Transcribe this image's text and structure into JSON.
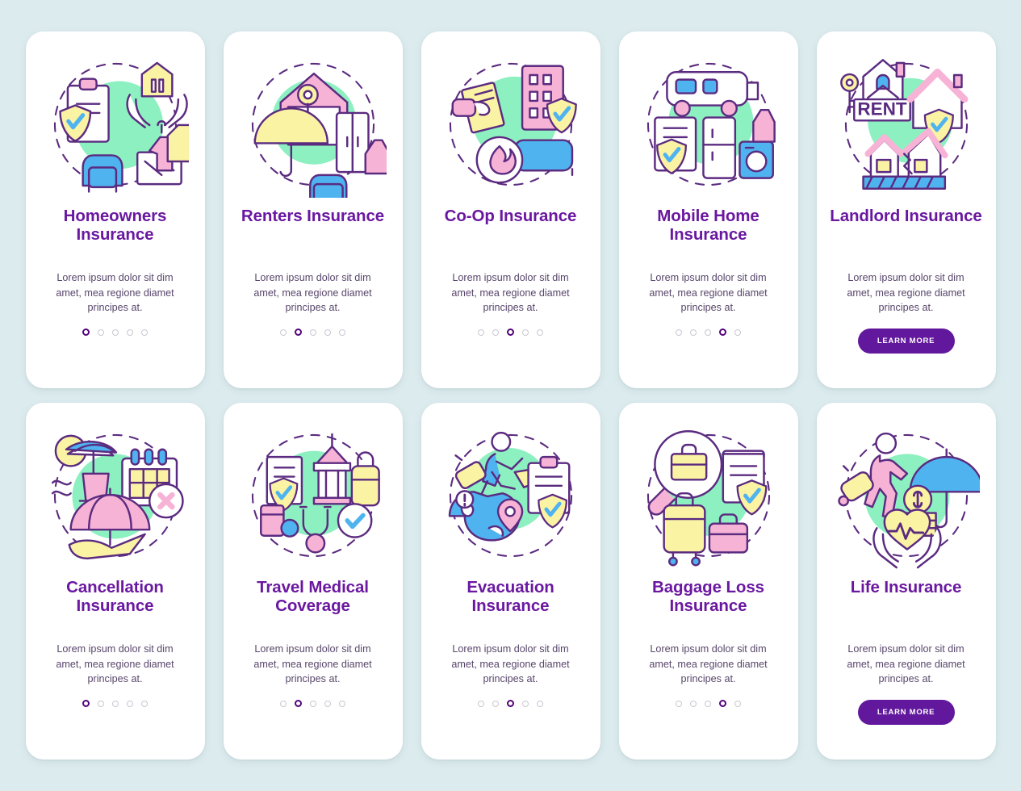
{
  "palette": {
    "page_background": "#dcebee",
    "card_background": "#ffffff",
    "title_purple": "#6a18a0",
    "body_text": "#58466b",
    "button_purple": "#62189c",
    "dot_active": "#53037a",
    "dot_inactive": "#c9c7d2",
    "illus_stroke": "#5b2b80",
    "illus_mint": "#8df0c0",
    "illus_yellow": "#fbf3a4",
    "illus_pink": "#f7b3d6",
    "illus_blue": "#4fb3f0",
    "illus_white": "#ffffff"
  },
  "shared": {
    "body_text": "Lorem ipsum dolor sit dim amet, mea regione diamet principes at.",
    "learn_more_label": "LEARN MORE",
    "dots_total": 5
  },
  "cards": [
    {
      "id": "homeowners-insurance",
      "title": "Homeowners Insurance",
      "body": "Lorem ipsum dolor sit dim amet, mea regione diamet principes at.",
      "footer": "dots",
      "dots_total": 5,
      "dots_active_index": 0,
      "illustration": "homeowners-illustration",
      "icon_elements": [
        "clipboard",
        "shield-check",
        "hands-holding-house",
        "armchair",
        "lamp",
        "table",
        "hanger-shirt"
      ]
    },
    {
      "id": "renters-insurance",
      "title": "Renters Insurance",
      "body": "Lorem ipsum dolor sit dim amet, mea regione diamet principes at.",
      "footer": "dots",
      "dots_total": 5,
      "dots_active_index": 1,
      "illustration": "renters-illustration",
      "icon_elements": [
        "house",
        "key",
        "umbrella",
        "sofa",
        "lamp",
        "wardrobe"
      ]
    },
    {
      "id": "co-op-insurance",
      "title": "Co-Op Insurance",
      "body": "Lorem ipsum dolor sit dim amet, mea regione diamet principes at.",
      "footer": "dots",
      "dots_total": 5,
      "dots_active_index": 2,
      "illustration": "coop-illustration",
      "icon_elements": [
        "hand-signing-contract",
        "apartment-building",
        "shield-check",
        "fire-circle",
        "sofa"
      ]
    },
    {
      "id": "mobile-home-insurance",
      "title": "Mobile Home Insurance",
      "body": "Lorem ipsum dolor sit dim amet, mea regione diamet principes at.",
      "footer": "dots",
      "dots_total": 5,
      "dots_active_index": 3,
      "illustration": "mobile-home-illustration",
      "icon_elements": [
        "camper-van",
        "document-shield",
        "refrigerator",
        "washing-machine",
        "lamp"
      ]
    },
    {
      "id": "landlord-insurance",
      "title": "Landlord Insurance",
      "body": "Lorem ipsum dolor sit dim amet, mea regione diamet principes at.",
      "footer": "button",
      "button_label": "LEARN MORE",
      "illustration": "landlord-illustration",
      "icon_elements": [
        "key",
        "house-rent-sign",
        "house-shield-check",
        "cracked-house"
      ]
    },
    {
      "id": "cancellation-insurance",
      "title": "Cancellation Insurance",
      "body": "Lorem ipsum dolor sit dim amet, mea regione diamet principes at.",
      "footer": "dots",
      "dots_total": 5,
      "dots_active_index": 0,
      "illustration": "cancellation-illustration",
      "icon_elements": [
        "sun",
        "beach-umbrella",
        "deck-chair",
        "waves",
        "calendar-cross",
        "umbrella",
        "airplane"
      ]
    },
    {
      "id": "travel-medical-coverage",
      "title": "Travel Medical Coverage",
      "body": "Lorem ipsum dolor sit dim amet, mea regione diamet principes at.",
      "footer": "dots",
      "dots_total": 5,
      "dots_active_index": 1,
      "illustration": "travel-medical-illustration",
      "icon_elements": [
        "document-shield",
        "pagoda",
        "backpack",
        "pill-bottle",
        "stethoscope",
        "check-circle"
      ]
    },
    {
      "id": "evacuation-insurance",
      "title": "Evacuation Insurance",
      "body": "Lorem ipsum dolor sit dim amet, mea regione diamet principes at.",
      "footer": "dots",
      "dots_total": 5,
      "dots_active_index": 2,
      "illustration": "evacuation-illustration",
      "icon_elements": [
        "running-person",
        "suitcase",
        "airplane",
        "globe-alert",
        "map-pin",
        "clipboard",
        "shield-check"
      ]
    },
    {
      "id": "baggage-loss-insurance",
      "title": "Baggage Loss Insurance",
      "body": "Lorem ipsum dolor sit dim amet, mea regione diamet principes at.",
      "footer": "dots",
      "dots_total": 5,
      "dots_active_index": 3,
      "illustration": "baggage-loss-illustration",
      "icon_elements": [
        "magnifier-briefcase",
        "document-shield-check",
        "suitcase",
        "handbag"
      ]
    },
    {
      "id": "life-insurance",
      "title": "Life Insurance",
      "body": "Lorem ipsum dolor sit dim amet, mea regione diamet principes at.",
      "footer": "button",
      "button_label": "LEARN MORE",
      "illustration": "life-illustration",
      "icon_elements": [
        "walking-person",
        "rolling-suitcase",
        "umbrella",
        "dollar-coins",
        "hands-holding-heart"
      ]
    }
  ]
}
